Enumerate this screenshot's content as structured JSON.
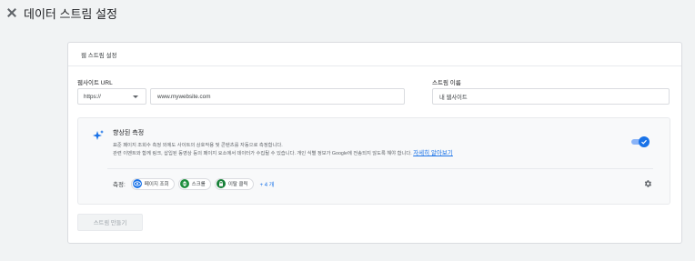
{
  "header": {
    "title": "데이터 스트림 설정"
  },
  "card": {
    "title": "웹 스트림 설정",
    "website_url": {
      "label": "웹사이트 URL",
      "protocol": "https://",
      "placeholder": "www.mywebsite.com"
    },
    "stream_name": {
      "label": "스트림 이름",
      "placeholder": "내 웹사이트"
    },
    "enhanced_measurement": {
      "title": "향상된 측정",
      "desc_line1": "표준 페이지 조회수 측정 외에도 사이트의 상호작용 및 콘텐츠를 자동으로 측정합니다.",
      "desc_line2": "관련 이벤트와 함께 링크, 삽입된 동영상 등의 페이지 요소에서 데이터가 수집될 수 있습니다. 개인 식별 정보가 Google에 전송되지 않도록 해야 합니다.",
      "learn_more": "자세히 알아보기",
      "enabled": true,
      "measuring_label": "측정:",
      "chips": [
        {
          "label": "페이지 조회",
          "icon": "eye-icon",
          "color": "#1a73e8"
        },
        {
          "label": "스크롤",
          "icon": "scroll-icon",
          "color": "#1e8e3e"
        },
        {
          "label": "이탈 클릭",
          "icon": "lock-icon",
          "color": "#188038"
        }
      ],
      "more": "+ 4 개"
    },
    "create_button": "스트림 만들기"
  },
  "colors": {
    "accent": "#1a73e8",
    "green": "#1e8e3e"
  }
}
